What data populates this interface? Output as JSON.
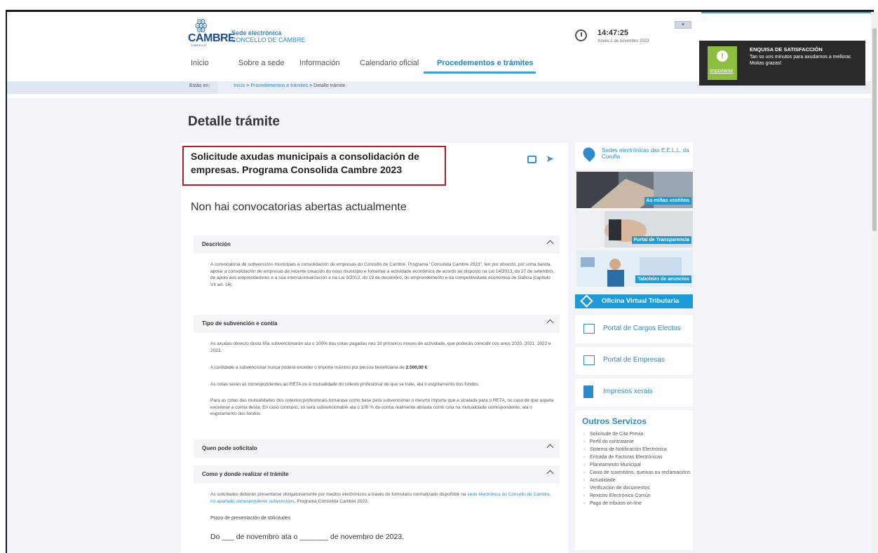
{
  "header": {
    "logo_text": "CAMBRE",
    "logo_sub": "CONCELLO",
    "sede_title": "Sede electrónica",
    "sede_sub": "CONCELLO DE CAMBRE",
    "time": "14:47:25",
    "date": "Xoves 2 de novembro 2023"
  },
  "nav": {
    "items": [
      "Inicio",
      "Sobre a sede",
      "Información",
      "Calendario oficial",
      "Procedementos e trámites"
    ],
    "active_index": 4
  },
  "breadcrumb": {
    "label": "Estás en:",
    "items": [
      "Inicio",
      "Procedementos e trámites",
      "Detalle trámite"
    ],
    "separator": ">"
  },
  "notification": {
    "badge_label": "Importante",
    "title": "ENQUISA DE SATISFACCIÓN",
    "text": "Tan so uns minutos para axudarnos a mellorar.",
    "thanks": "Moitas grazas!"
  },
  "main": {
    "page_title": "Detalle trámite",
    "procedure_title": "Solicitude axudas municipais a consolidación de empresas. Programa Consolida Cambre 2023",
    "no_calls": "Non hai convocatorias abertas actualmente",
    "sections": [
      {
        "title": "Descrición",
        "paragraphs": [
          "A convocatoria de subvencións municipais á consolidación de empresas do Concello de Cambre, Programa \"Consolida Cambre 2023\", ten por obxecto, por unha banda, apoiar a consolidación de empresas de recente creación do noso municipio e fomentar a actividade económica de acordo ao disposto na Lei 14/2013, do 27 de setembro, de apoio aos emprendedores e a súa internacionalización e na Lei 9/2013, do 19 de decembro, do emprendemento e da competitividade económica de Galicia (capítulo VII art. 16)."
        ]
      },
      {
        "title": "Tipo de subvención e contía",
        "paragraphs": [
          "As axudas obxecto desta liña subvencionarán ata o 100% das cotas pagadas nos 18 primeiros meses de actividade, que poderán coincidir cos anos 2020, 2021, 2022 e 2023.",
          "A cantidade a subvencionar nunca poderá exceder o importe máximo por persoa beneficiaria de",
          "2.500,00 €",
          "As cotas serán as correspondentes ao RETA ou á mutualidade do colexio profesional de que se trate, ata o esgotamento dos fondos.",
          "Para as cotas das mutualidades dos colexios profesionais tomarase como base para subvencionar o mesmo importe que a sinalada para o RETA, no caso de que aquela excedese a contía desta. En caso contrario, só será subvencionable ata o 100 % da contía realmente aboada como cota na mutualidade correspondente, ata o esgotamento dos fondos."
        ]
      },
      {
        "title": "Quen pode solicitalo",
        "paragraphs": []
      },
      {
        "title": "Como y donde realizar el trámite",
        "paragraphs": [
          "As solicitudes deberán presentarse obrigatoriamente por medios electrónicos a través do formulario normalizado dispoñible na",
          "sede electrónica do Concello de Cambre, no apartado correspondente subvencións",
          ", Programa Consolida Cambre 2023."
        ],
        "label": "Prazo de presentación de solicitudes",
        "deadline": "Do ___ de novembro ata o _______ de novembro de 2023."
      }
    ]
  },
  "sidebar": {
    "sedes": "Sedes electrónicas das E.E.L.L. da Coruña",
    "promos": [
      "As miñas xestións",
      "Portal de Transparencia",
      "Taboleiro de anuncios"
    ],
    "ovt": "Oficina Virtual Tributaria",
    "links": [
      "Portal de Cargos Electos",
      "Portal de Empresas",
      "Impresos xerais"
    ],
    "outros_title": "Outros Servizos",
    "outros_items": [
      "Solicitude de Cita Previa",
      "Perfil do contratante",
      "Sistema de Notificación Electrónica",
      "Entrada de Facturas Electrónicas",
      "Planeamento Municipal",
      "Caixa de suxestións, queixas ou reclamacións",
      "Actualidade",
      "Verificación de documentos",
      "Rexistro Electrónico Común",
      "Pago de tributos on-line"
    ]
  },
  "colors": {
    "accent": "#1d9bd8",
    "link": "#2d8bc9",
    "highlight_box": "#b31e23",
    "notify_badge": "#8dbf3e"
  }
}
